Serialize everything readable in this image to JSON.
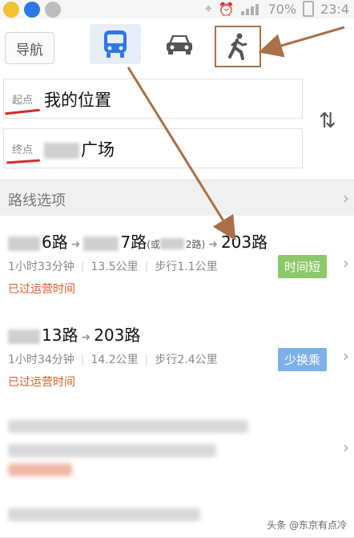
{
  "status_bar": {
    "battery": "70%",
    "time": "23:4"
  },
  "nav": {
    "back_label": "导航",
    "modes": [
      {
        "name": "bus-icon",
        "active": true
      },
      {
        "name": "car-icon",
        "active": false
      },
      {
        "name": "walk-icon",
        "active": false
      }
    ]
  },
  "route_form": {
    "start_tag": "起点",
    "start_value": "我的位置",
    "end_tag": "终点",
    "end_value": "广场"
  },
  "options_header": "路线选项",
  "routes": [
    {
      "seg1": "6路",
      "seg2": "7路",
      "alt_open": "(或",
      "alt_suffix": "2路)",
      "seg3": "203路",
      "duration": "1小时33分钟",
      "distance": "13.5公里",
      "walk": "步行1.1公里",
      "badge": "时间短",
      "notice": "已过运营时间"
    },
    {
      "seg1": "13路",
      "seg2": "203路",
      "duration": "1小时34分钟",
      "distance": "14.2公里",
      "walk": "步行2.4公里",
      "badge": "少换乘",
      "notice": "已过运营时间"
    }
  ],
  "watermark": "头条 @东京有点冷",
  "colors": {
    "accent_blue": "#2e78e6",
    "badge_green": "#8cc96a",
    "badge_blue": "#7cb0e8",
    "notice": "#e05a2a",
    "annotation": "#a9704a"
  }
}
